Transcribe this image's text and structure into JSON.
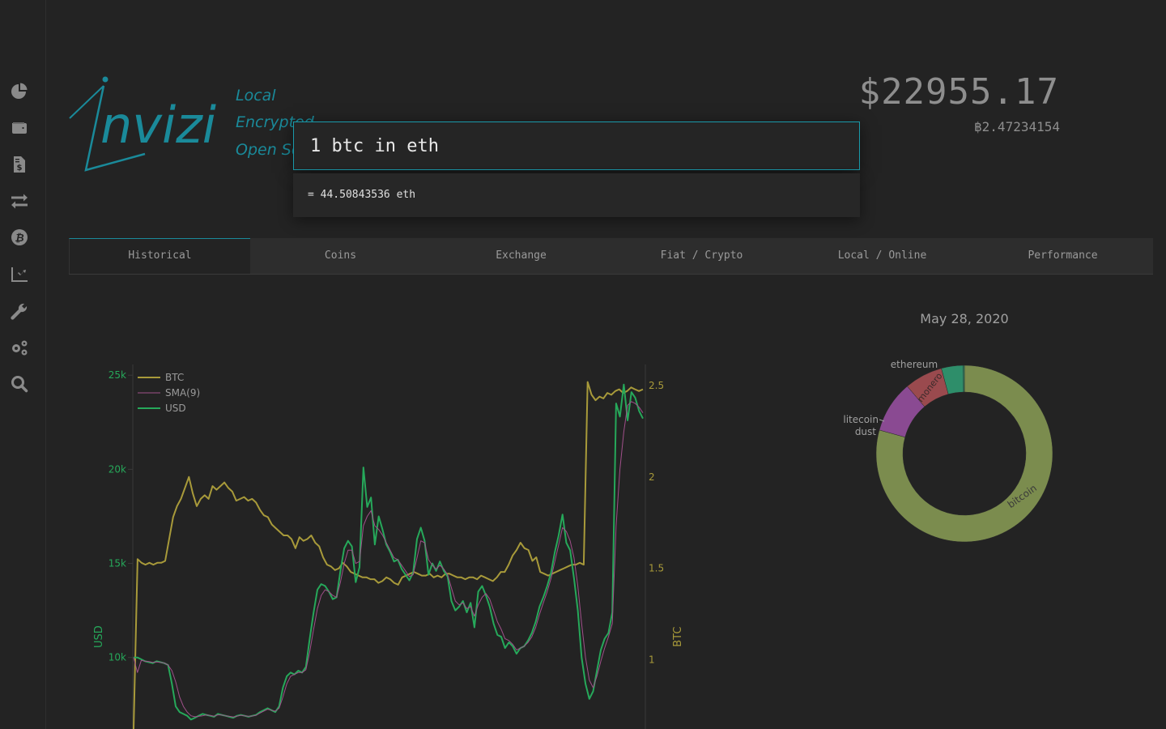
{
  "sidebar": {
    "items": [
      {
        "icon": "pie-chart-icon",
        "label": "Portfolio"
      },
      {
        "icon": "wallet-icon",
        "label": "Wallets"
      },
      {
        "icon": "invoice-icon",
        "label": "Transactions"
      },
      {
        "icon": "exchange-arrows-icon",
        "label": "Exchange"
      },
      {
        "icon": "bitcoin-icon",
        "label": "Coins"
      },
      {
        "icon": "line-chart-icon",
        "label": "Charts"
      },
      {
        "icon": "wrench-icon",
        "label": "Tools"
      },
      {
        "icon": "gears-icon",
        "label": "Settings"
      },
      {
        "icon": "search-icon",
        "label": "Search"
      }
    ]
  },
  "brand": {
    "name": "invizi",
    "taglines": [
      "Local",
      "Encrypted",
      "Open Source"
    ],
    "accent": "#1a8a9a"
  },
  "balance": {
    "usd": "$22955.17",
    "btc": "฿2.47234154"
  },
  "command": {
    "query": "1 btc in eth",
    "result": "= 44.50843536 eth"
  },
  "tabs": [
    {
      "label": "Historical",
      "active": true
    },
    {
      "label": "Coins",
      "active": false
    },
    {
      "label": "Exchange",
      "active": false
    },
    {
      "label": "Fiat / Crypto",
      "active": false
    },
    {
      "label": "Local / Online",
      "active": false
    },
    {
      "label": "Performance",
      "active": false
    }
  ],
  "chart_data": [
    {
      "type": "line",
      "title": "",
      "ylabel": "USD",
      "y2label": "BTC",
      "ylim": [
        6200,
        26000
      ],
      "y2lim": [
        0.62,
        2.66
      ],
      "yticks": [
        10000,
        15000,
        20000,
        25000
      ],
      "ytick_labels": [
        "10k",
        "15k",
        "20k",
        "25k"
      ],
      "y2ticks": [
        1,
        1.5,
        2,
        2.5
      ],
      "y2tick_labels": [
        "1",
        "1.5",
        "2",
        "2.5"
      ],
      "legend": {
        "position": "top-left",
        "entries": [
          "BTC",
          "SMA(9)",
          "USD"
        ]
      },
      "colors": {
        "BTC": "#a89a3a",
        "SMA(9)": "#a0508a",
        "USD": "#26a85a",
        "axis_usd": "#26a85a",
        "axis_btc": "#a89a3a"
      },
      "x_count": 120,
      "series": [
        {
          "name": "USD",
          "axis": "left",
          "values": [
            10000,
            10000,
            9900,
            9800,
            9750,
            9700,
            9800,
            9750,
            9700,
            9600,
            8600,
            7400,
            7100,
            7000,
            6900,
            6700,
            6800,
            6900,
            7000,
            6950,
            6900,
            6850,
            7000,
            6950,
            6900,
            6850,
            6800,
            6900,
            6950,
            6900,
            6850,
            6900,
            6950,
            7100,
            7200,
            7300,
            7200,
            7100,
            7400,
            8400,
            9000,
            9200,
            9100,
            9300,
            9200,
            9500,
            11000,
            12400,
            13600,
            13900,
            13800,
            13500,
            13100,
            13200,
            14600,
            15800,
            16200,
            15900,
            14000,
            14800,
            20100,
            18000,
            18500,
            16000,
            17500,
            16800,
            16000,
            15600,
            15100,
            15200,
            14700,
            14400,
            14100,
            14500,
            16300,
            16900,
            16200,
            14400,
            15000,
            14600,
            15100,
            14600,
            14300,
            13000,
            12500,
            12700,
            13000,
            12400,
            12900,
            11600,
            13500,
            13800,
            13300,
            12700,
            11800,
            11200,
            11100,
            10500,
            10800,
            10600,
            10200,
            10500,
            10600,
            10900,
            11300,
            11900,
            12700,
            13200,
            13800,
            14500,
            15600,
            16500,
            17600,
            16100,
            15700,
            14200,
            12500,
            10000,
            8600,
            7800,
            8200,
            9300,
            10400,
            11000,
            11300,
            12400,
            23500,
            22800,
            24500,
            22600,
            24100,
            23800,
            23100,
            22700
          ]
        },
        {
          "name": "SMA(9)",
          "axis": "left",
          "values": [
            10000,
            9200,
            9850,
            9800,
            9780,
            9740,
            9760,
            9740,
            9710,
            9600,
            9300,
            8700,
            7900,
            7400,
            7100,
            6900,
            6850,
            6880,
            6900,
            6950,
            6920,
            6880,
            6950,
            6950,
            6900,
            6870,
            6840,
            6880,
            6930,
            6900,
            6870,
            6890,
            6930,
            7050,
            7150,
            7250,
            7200,
            7150,
            7300,
            7900,
            8600,
            9000,
            9100,
            9200,
            9200,
            9350,
            10300,
            11500,
            12600,
            13300,
            13600,
            13500,
            13300,
            13200,
            14000,
            15000,
            15700,
            15700,
            15000,
            15100,
            17000,
            17500,
            17800,
            17000,
            16800,
            16500,
            16100,
            15700,
            15300,
            15200,
            14900,
            14600,
            14300,
            14400,
            15300,
            16200,
            16100,
            15200,
            14900,
            14700,
            14900,
            14700,
            14400,
            13700,
            13000,
            12800,
            12900,
            12600,
            12700,
            12200,
            12800,
            13200,
            13400,
            13100,
            12500,
            11900,
            11500,
            11000,
            10900,
            10700,
            10400,
            10500,
            10600,
            10800,
            11100,
            11600,
            12300,
            12900,
            13500,
            14200,
            15100,
            16000,
            16900,
            16700,
            16200,
            15300,
            13800,
            11800,
            10000,
            8800,
            8400,
            9000,
            9800,
            10500,
            11100,
            11800,
            17000,
            20000,
            22000,
            23400,
            23600,
            23500,
            23300,
            23000
          ]
        },
        {
          "name": "BTC",
          "axis": "right",
          "values": [
            0.62,
            1.55,
            1.53,
            1.52,
            1.53,
            1.52,
            1.53,
            1.53,
            1.54,
            1.66,
            1.78,
            1.84,
            1.88,
            1.94,
            2.0,
            1.91,
            1.84,
            1.88,
            1.9,
            1.88,
            1.95,
            1.93,
            1.95,
            1.97,
            1.94,
            1.92,
            1.87,
            1.88,
            1.89,
            1.87,
            1.88,
            1.86,
            1.82,
            1.79,
            1.78,
            1.74,
            1.72,
            1.7,
            1.68,
            1.68,
            1.66,
            1.61,
            1.67,
            1.65,
            1.66,
            1.68,
            1.64,
            1.62,
            1.56,
            1.52,
            1.51,
            1.49,
            1.5,
            1.53,
            1.51,
            1.48,
            1.47,
            1.46,
            1.45,
            1.45,
            1.44,
            1.44,
            1.42,
            1.43,
            1.45,
            1.44,
            1.42,
            1.41,
            1.45,
            1.46,
            1.47,
            1.48,
            1.47,
            1.46,
            1.46,
            1.47,
            1.45,
            1.46,
            1.45,
            1.47,
            1.47,
            1.46,
            1.45,
            1.45,
            1.44,
            1.45,
            1.45,
            1.44,
            1.46,
            1.45,
            1.44,
            1.43,
            1.45,
            1.48,
            1.48,
            1.52,
            1.57,
            1.6,
            1.64,
            1.61,
            1.6,
            1.54,
            1.56,
            1.48,
            1.47,
            1.46,
            1.47,
            1.48,
            1.49,
            1.5,
            1.51,
            1.52,
            1.52,
            1.53,
            1.52,
            2.52,
            2.45,
            2.42,
            2.44,
            2.43,
            2.46,
            2.45,
            2.47,
            2.48,
            2.46,
            2.47,
            2.49,
            2.48,
            2.47,
            2.48
          ]
        }
      ]
    },
    {
      "type": "pie",
      "title": "May 28, 2020",
      "hole": true,
      "labels": [
        "bitcoin",
        "ethereum",
        "monero",
        "litecoin",
        "dust"
      ],
      "values": [
        79.3,
        9.5,
        7.0,
        4.0,
        0.2
      ],
      "colors": [
        "#7b8c4e",
        "#8a4a92",
        "#9a4a4e",
        "#2e8e6a",
        "#2e8e6a"
      ]
    }
  ]
}
